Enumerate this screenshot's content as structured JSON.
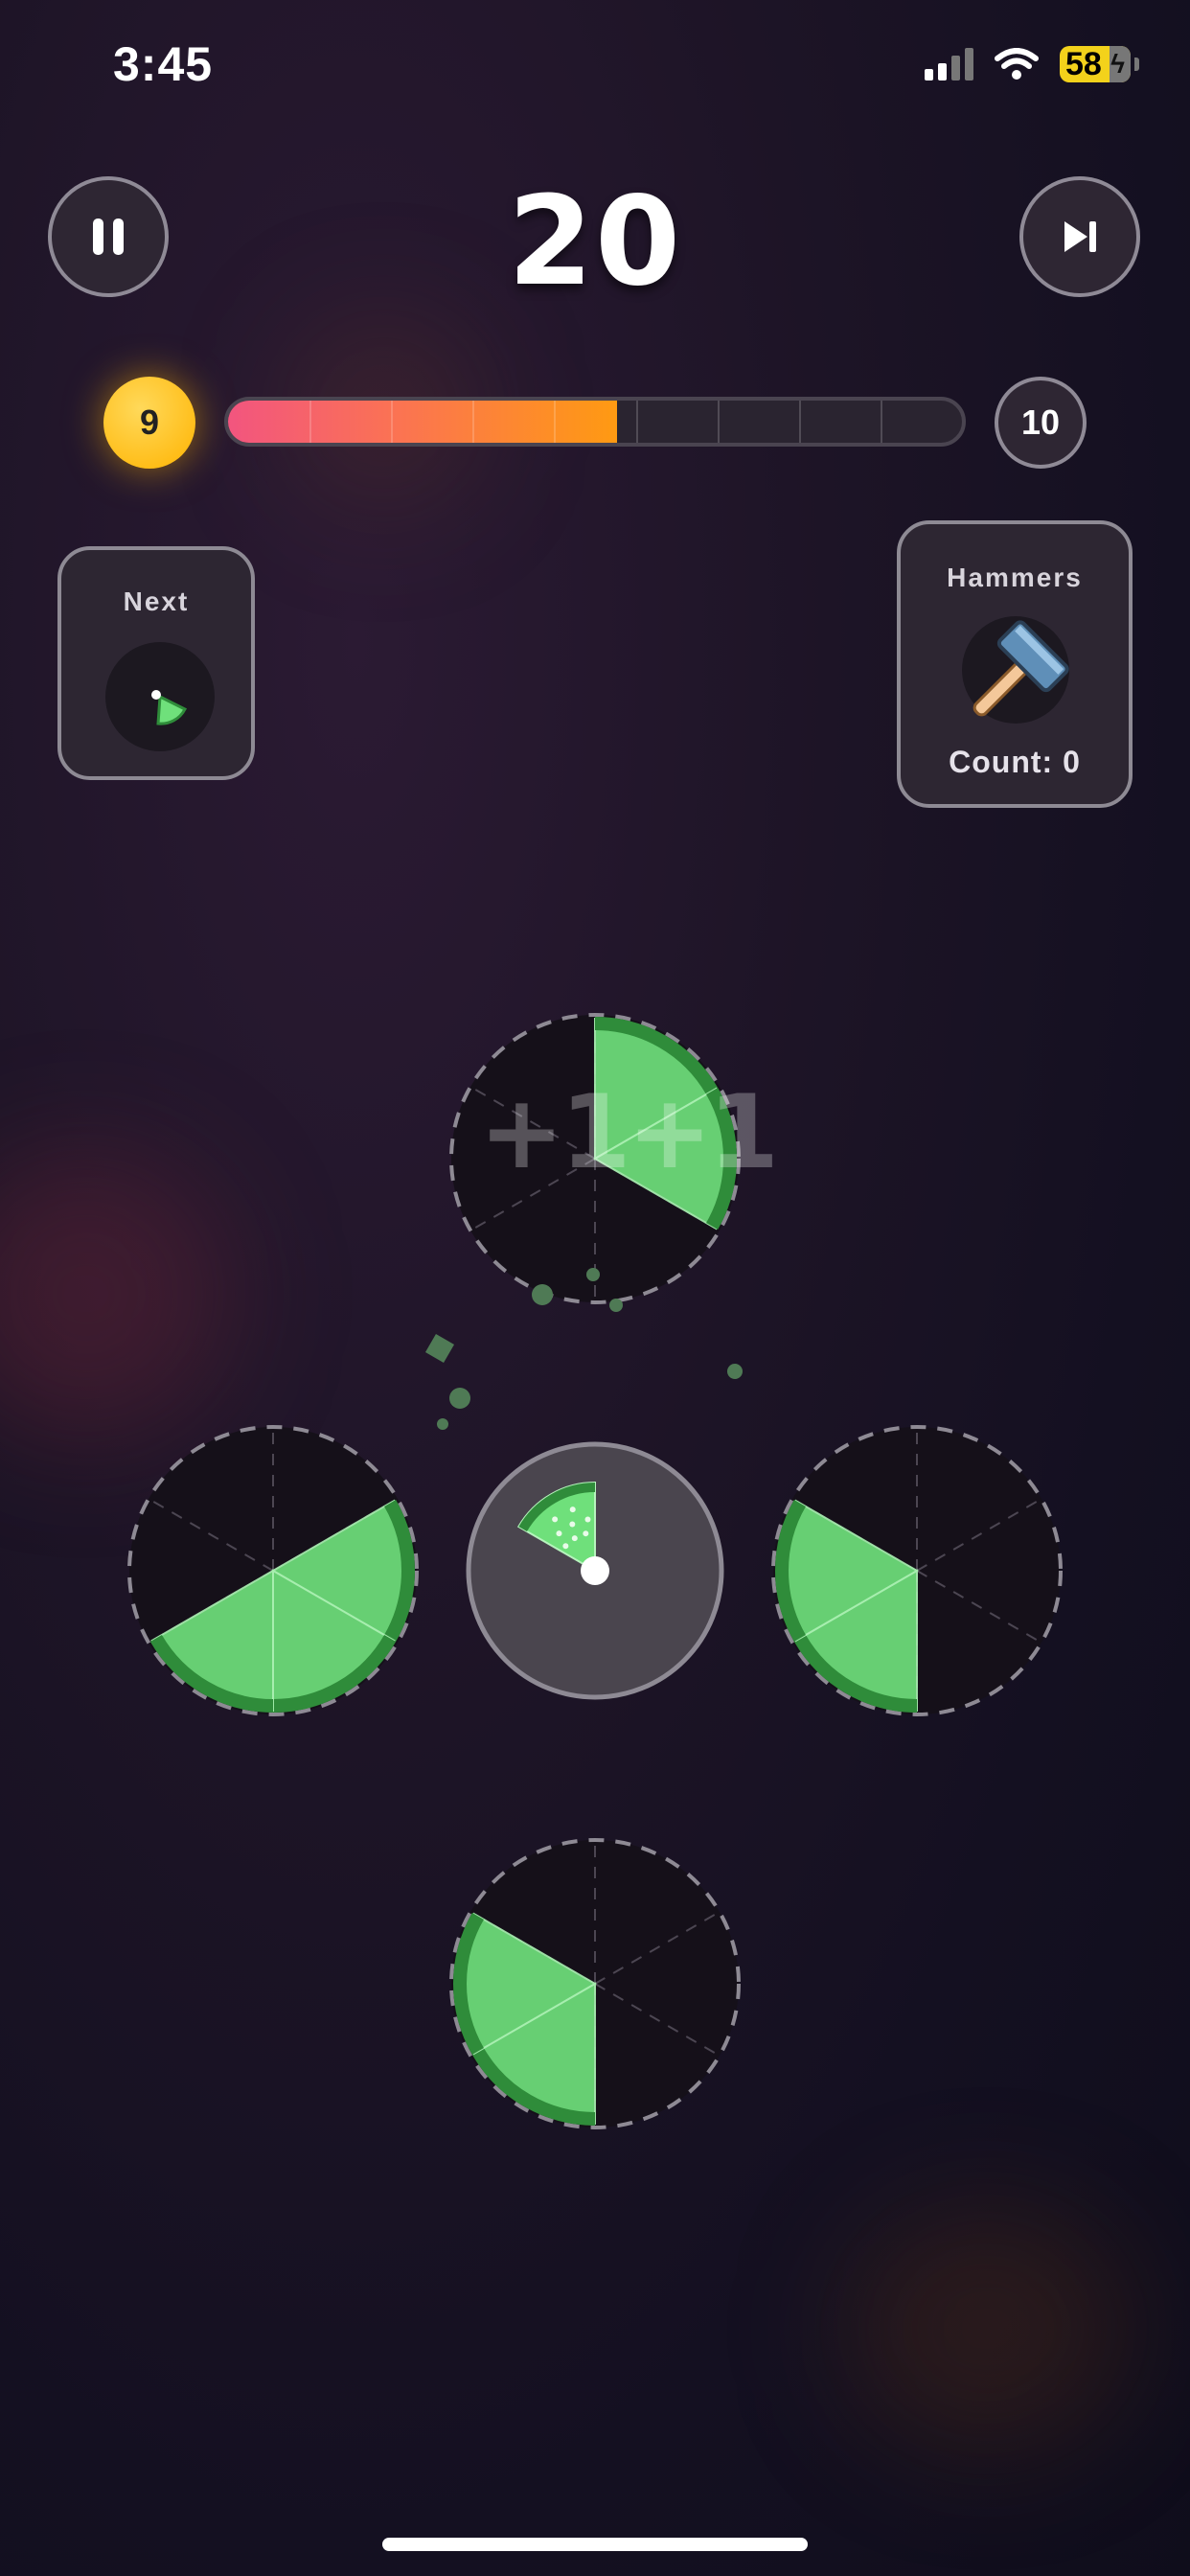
{
  "status_bar": {
    "time": "3:45",
    "battery_level": "58"
  },
  "score": "20",
  "progress": {
    "current_level": "9",
    "next_level": "10",
    "fraction": 0.53,
    "segments": 9
  },
  "next_panel": {
    "label": "Next"
  },
  "hammers_panel": {
    "label": "Hammers",
    "count_text": "Count: 0"
  },
  "floating_text": "+1+1",
  "colors": {
    "accent": "#ffb300",
    "slice_light": "#6fe07b",
    "slice_dark": "#2f8c3a",
    "progress_start": "#f2557f",
    "progress_end": "#ff9a12"
  },
  "icons": [
    "pause-icon",
    "skip-icon",
    "hammer-icon",
    "slice-icon"
  ],
  "board": {
    "total_slots": 6,
    "plates": [
      {
        "name": "plate-top",
        "filled": [
          0,
          1
        ]
      },
      {
        "name": "plate-left",
        "filled": [
          1,
          2,
          3
        ]
      },
      {
        "name": "plate-right",
        "filled": [
          3,
          4
        ]
      },
      {
        "name": "plate-bottom",
        "filled": [
          3,
          4
        ]
      }
    ],
    "center_piece": {
      "filled": [
        5
      ]
    }
  }
}
